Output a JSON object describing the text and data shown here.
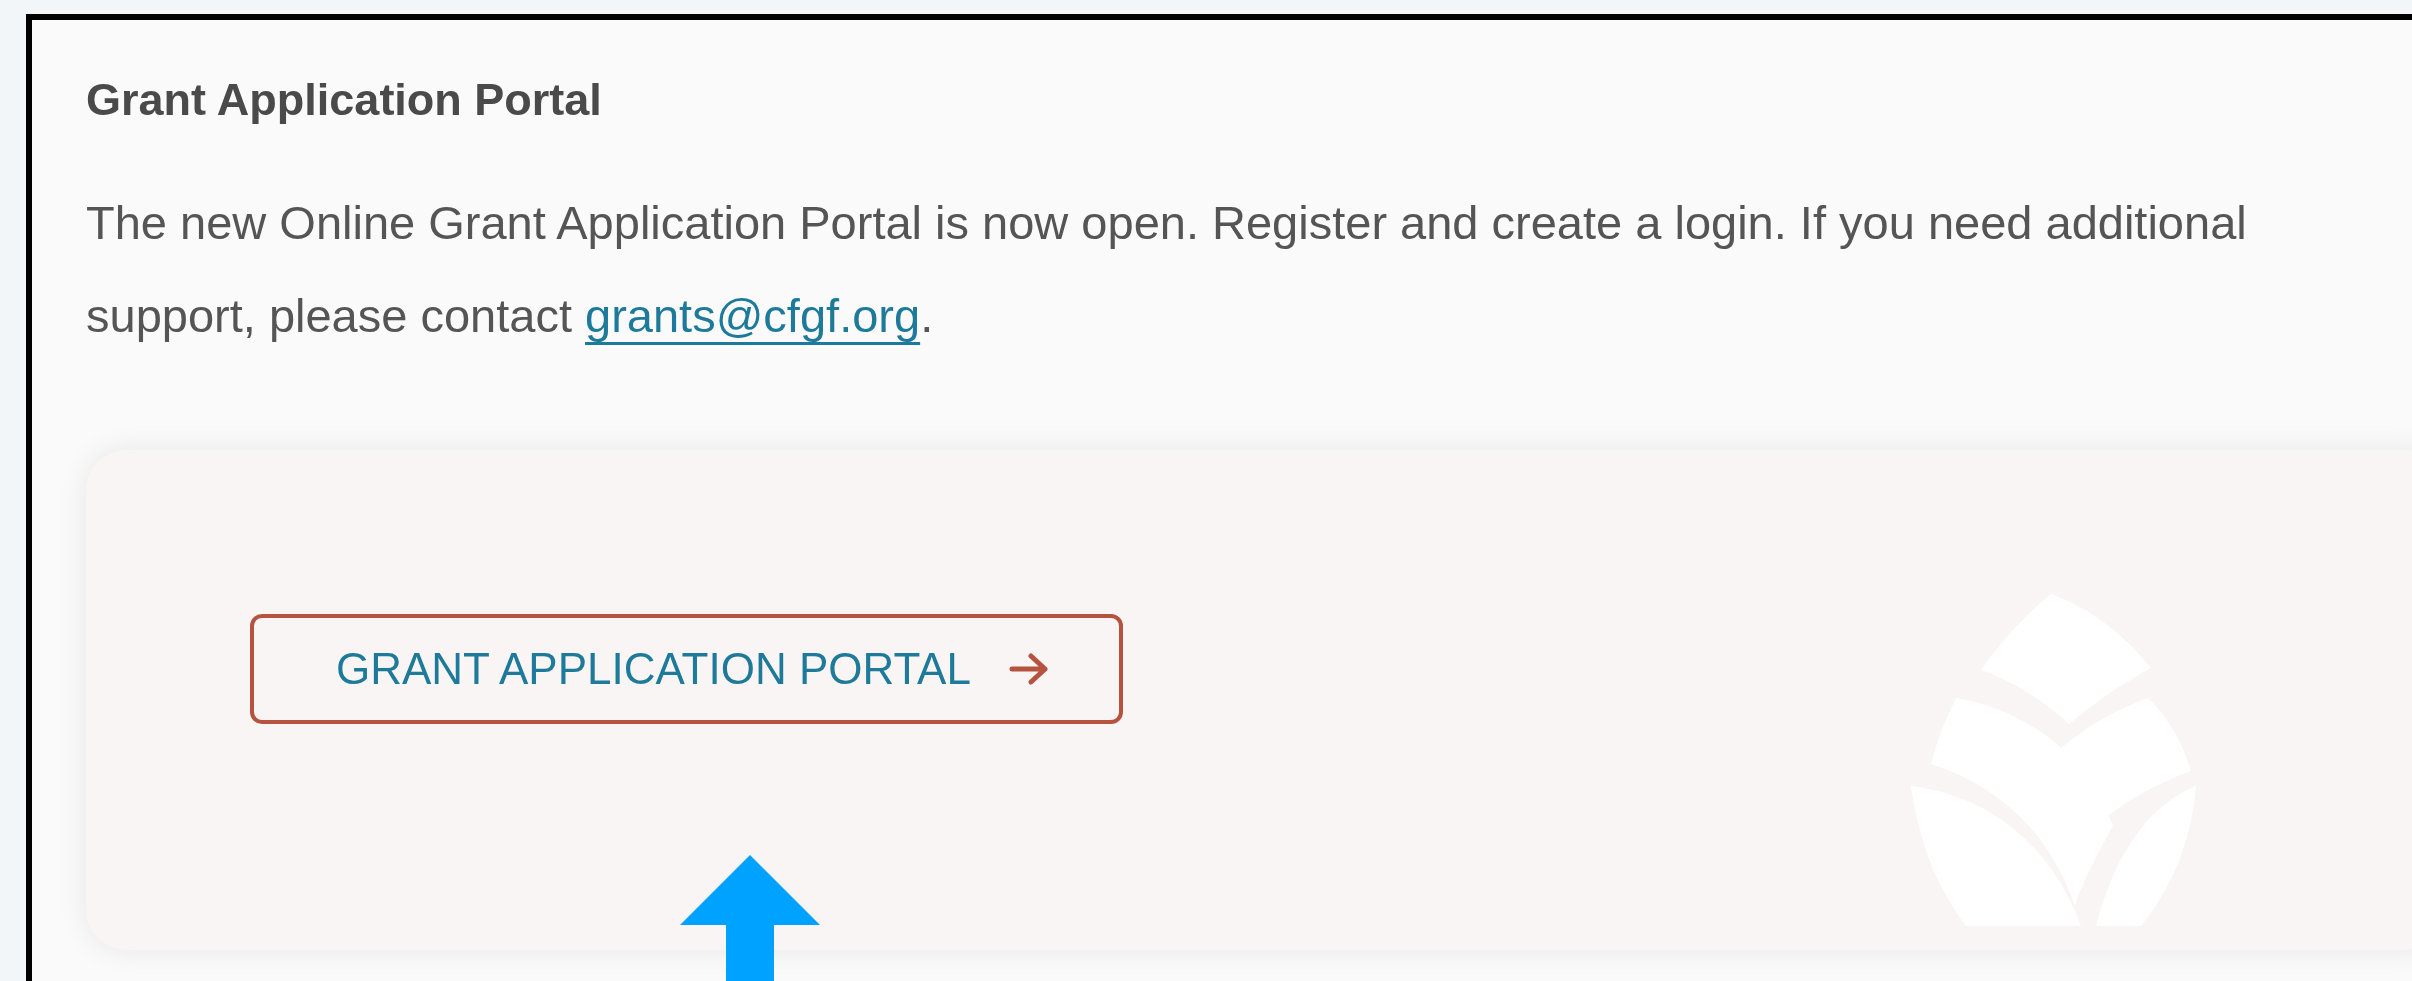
{
  "section": {
    "title": "Grant Application Portal",
    "paragraph": {
      "text_before": "The new Online Grant Application Portal is now open. Register and create a login. If you need additional support, please contact ",
      "link": "grants@cfgf.org",
      "text_after": "."
    }
  },
  "card": {
    "button": {
      "label": "GRANT APPLICATION PORTAL"
    }
  }
}
